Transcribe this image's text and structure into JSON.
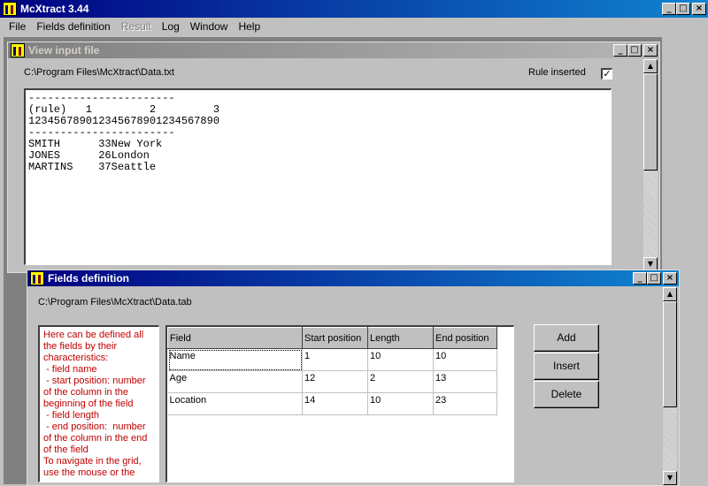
{
  "app": {
    "title": "McXtract 3.44",
    "caption_minimize": "_",
    "caption_maximize": "□",
    "caption_close": "×"
  },
  "menu": {
    "items": [
      {
        "label": "File",
        "enabled": true
      },
      {
        "label": "Fields definition",
        "enabled": true
      },
      {
        "label": "Result",
        "enabled": false
      },
      {
        "label": "Log",
        "enabled": true
      },
      {
        "label": "Window",
        "enabled": true
      },
      {
        "label": "Help",
        "enabled": true
      }
    ]
  },
  "view_input": {
    "title": "View input file",
    "path": "C:\\Program Files\\McXtract\\Data.txt",
    "rule_inserted_label": "Rule inserted",
    "rule_inserted_checked": true,
    "check_mark": "✓",
    "content": "-----------------------\n(rule)   1         2         3\n123456789012345678901234567890\n-----------------------\nSMITH      33New York\nJONES      26London\nMARTINS    37Seattle"
  },
  "fields_def": {
    "title": "Fields definition",
    "path": "C:\\Program Files\\McXtract\\Data.tab",
    "help_text": "Here can be defined all the fields by their characteristics:\n - field name\n - start position: number of the column in the beginning of the field\n - field length\n - end position:  number of the column in the end of the field\nTo navigate in the grid, use the mouse or the",
    "columns": [
      "Field",
      "Start position",
      "Length",
      "End position"
    ],
    "rows": [
      [
        "Name",
        "1",
        "10",
        "10"
      ],
      [
        "Age",
        "12",
        "2",
        "13"
      ],
      [
        "Location",
        "14",
        "10",
        "23"
      ]
    ],
    "buttons": {
      "add": "Add",
      "insert": "Insert",
      "delete": "Delete"
    }
  },
  "scroll": {
    "up": "▲",
    "down": "▼"
  },
  "colors": {
    "title_active": "#000080",
    "title_inactive": "#808080",
    "help_text": "#c00000"
  }
}
